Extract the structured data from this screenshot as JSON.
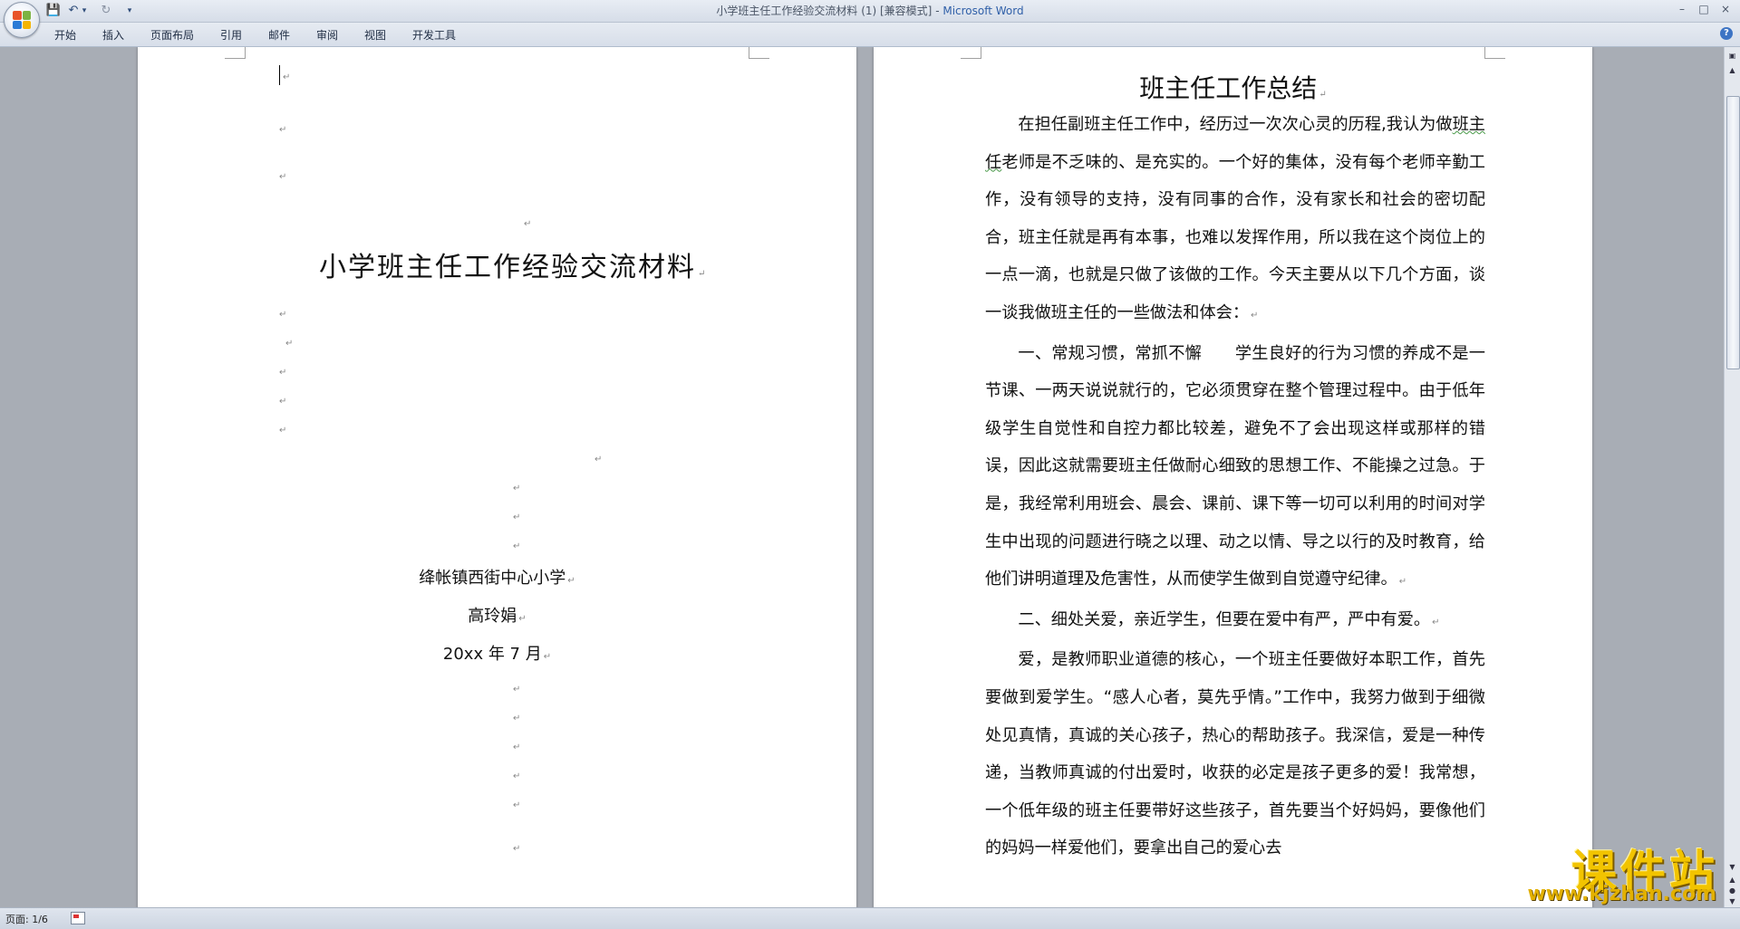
{
  "window": {
    "title": "小学班主任工作经验交流材料 (1) [兼容模式]",
    "title_app": "Microsoft Word",
    "controls": [
      "–",
      "□",
      "×"
    ]
  },
  "quick_access": {
    "save_icon": "save-icon",
    "undo_icon": "undo-icon",
    "redo_icon": "redo-icon",
    "customize_icon": "dropdown-icon"
  },
  "ribbon": {
    "tabs": [
      "开始",
      "插入",
      "页面布局",
      "引用",
      "邮件",
      "审阅",
      "视图",
      "开发工具"
    ],
    "help": "?"
  },
  "cover_page": {
    "title": "小学班主任工作经验交流材料",
    "school": "绛帐镇西街中心小学",
    "author": "高玲娟",
    "date": "20xx 年 7 月"
  },
  "content_page": {
    "title": "班主任工作总结",
    "p1_before": "在担任副班主任工作中，经历过一次次心灵的历程,我认为做",
    "p1_wavy": "班主任",
    "p1_after": "老师是不乏味的、是充实的。一个好的集体，没有每个老师辛勤工作，没有领导的支持，没有同事的合作，没有家长和社会的密切配合，班主任就是再有本事，也难以发挥作用，所以我在这个岗位上的一点一滴，也就是只做了该做的工作。今天主要从以下几个方面，谈一谈我做班主任的一些做法和体会：",
    "p2": "一、常规习惯，常抓不懈　　学生良好的行为习惯的养成不是一节课、一两天说说就行的，它必须贯穿在整个管理过程中。由于低年级学生自觉性和自控力都比较差，避免不了会出现这样或那样的错误，因此这就需要班主任做耐心细致的思想工作、不能操之过急。于是，我经常利用班会、晨会、课前、课下等一切可以利用的时间对学生中出现的问题进行晓之以理、动之以情、导之以行的及时教育，给他们讲明道理及危害性，从而使学生做到自觉遵守纪律。",
    "p3": "二、细处关爱，亲近学生，但要在爱中有严，严中有爱。",
    "p4": "爱，是教师职业道德的核心，一个班主任要做好本职工作，首先要做到爱学生。“感人心者，莫先乎情。”工作中，我努力做到于细微处见真情，真诚的关心孩子，热心的帮助孩子。我深信，爱是一种传递，当教师真诚的付出爱时，收获的必定是孩子更多的爱！我常想，一个低年级的班主任要带好这些孩子，首先要当个好妈妈，要像他们的妈妈一样爱他们，要拿出自己的爱心去"
  },
  "statusbar": {
    "page_info": "页面: 1/6"
  },
  "watermark": {
    "line1": "课件站",
    "line2": "www.kjzhan.com"
  },
  "colors": {
    "ribbon_bg": "#dfe5ee",
    "title_app": "#2f5fa8",
    "watermark": "#f2c400",
    "workspace": "#a8adb5"
  }
}
